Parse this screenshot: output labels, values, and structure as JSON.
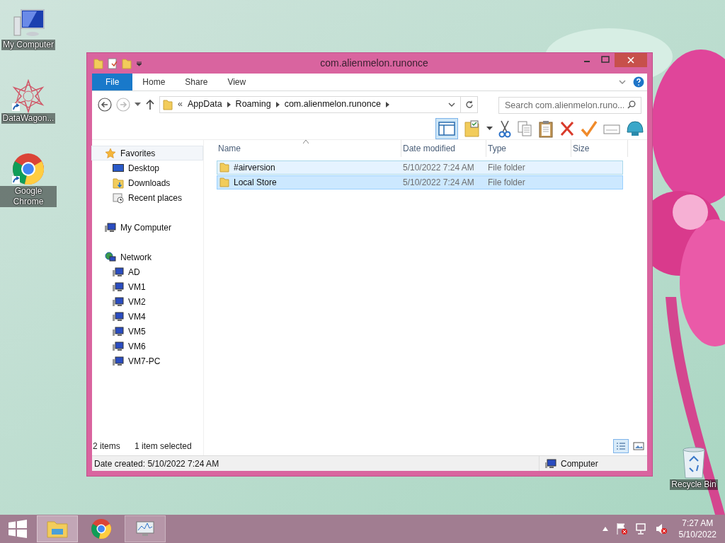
{
  "desktop_icons": [
    {
      "label": "My Computer",
      "kind": "computer"
    },
    {
      "label": "DataWagon...",
      "kind": "star"
    },
    {
      "label": "Google Chrome",
      "kind": "chrome"
    },
    {
      "label": "Recycle Bin",
      "kind": "bin"
    }
  ],
  "window": {
    "title": "com.alienmelon.runonce"
  },
  "ribbon_tabs": [
    {
      "label": "File",
      "selected": true
    },
    {
      "label": "Home",
      "selected": false
    },
    {
      "label": "Share",
      "selected": false
    },
    {
      "label": "View",
      "selected": false
    }
  ],
  "address_bar": {
    "overflow": "«",
    "segments": [
      "AppData",
      "Roaming",
      "com.alienmelon.runonce"
    ]
  },
  "search": {
    "placeholder": "Search com.alienmelon.runo..."
  },
  "navigation": [
    {
      "label": "Favorites",
      "kind": "star",
      "hovered": true,
      "children": [
        {
          "label": "Desktop",
          "kind": "desktop"
        },
        {
          "label": "Downloads",
          "kind": "downloads"
        },
        {
          "label": "Recent places",
          "kind": "recent"
        }
      ]
    },
    {
      "label": "My Computer",
      "kind": "computer",
      "hovered": false
    },
    {
      "label": "Network",
      "kind": "network",
      "hovered": false,
      "children": [
        {
          "label": "AD",
          "kind": "computer"
        },
        {
          "label": "VM1",
          "kind": "computer"
        },
        {
          "label": "VM2",
          "kind": "computer"
        },
        {
          "label": "VM4",
          "kind": "computer"
        },
        {
          "label": "VM5",
          "kind": "computer"
        },
        {
          "label": "VM6",
          "kind": "computer"
        },
        {
          "label": "VM7-PC",
          "kind": "computer"
        }
      ]
    }
  ],
  "table": {
    "columns": [
      "Name",
      "Date modified",
      "Type",
      "Size"
    ],
    "rows": [
      {
        "name": "#airversion",
        "date_modified": "5/10/2022 7:24 AM",
        "type": "File folder",
        "selected": false,
        "hovered": true
      },
      {
        "name": "Local Store",
        "date_modified": "5/10/2022 7:24 AM",
        "type": "File folder",
        "selected": true,
        "hovered": false
      }
    ]
  },
  "status": {
    "count": "2 items",
    "selection": "1 item selected"
  },
  "details_bar": {
    "text": "Date created: 5/10/2022 7:24 AM",
    "location": "Computer"
  },
  "clock": {
    "time": "7:27 AM",
    "date": "5/10/2022"
  }
}
